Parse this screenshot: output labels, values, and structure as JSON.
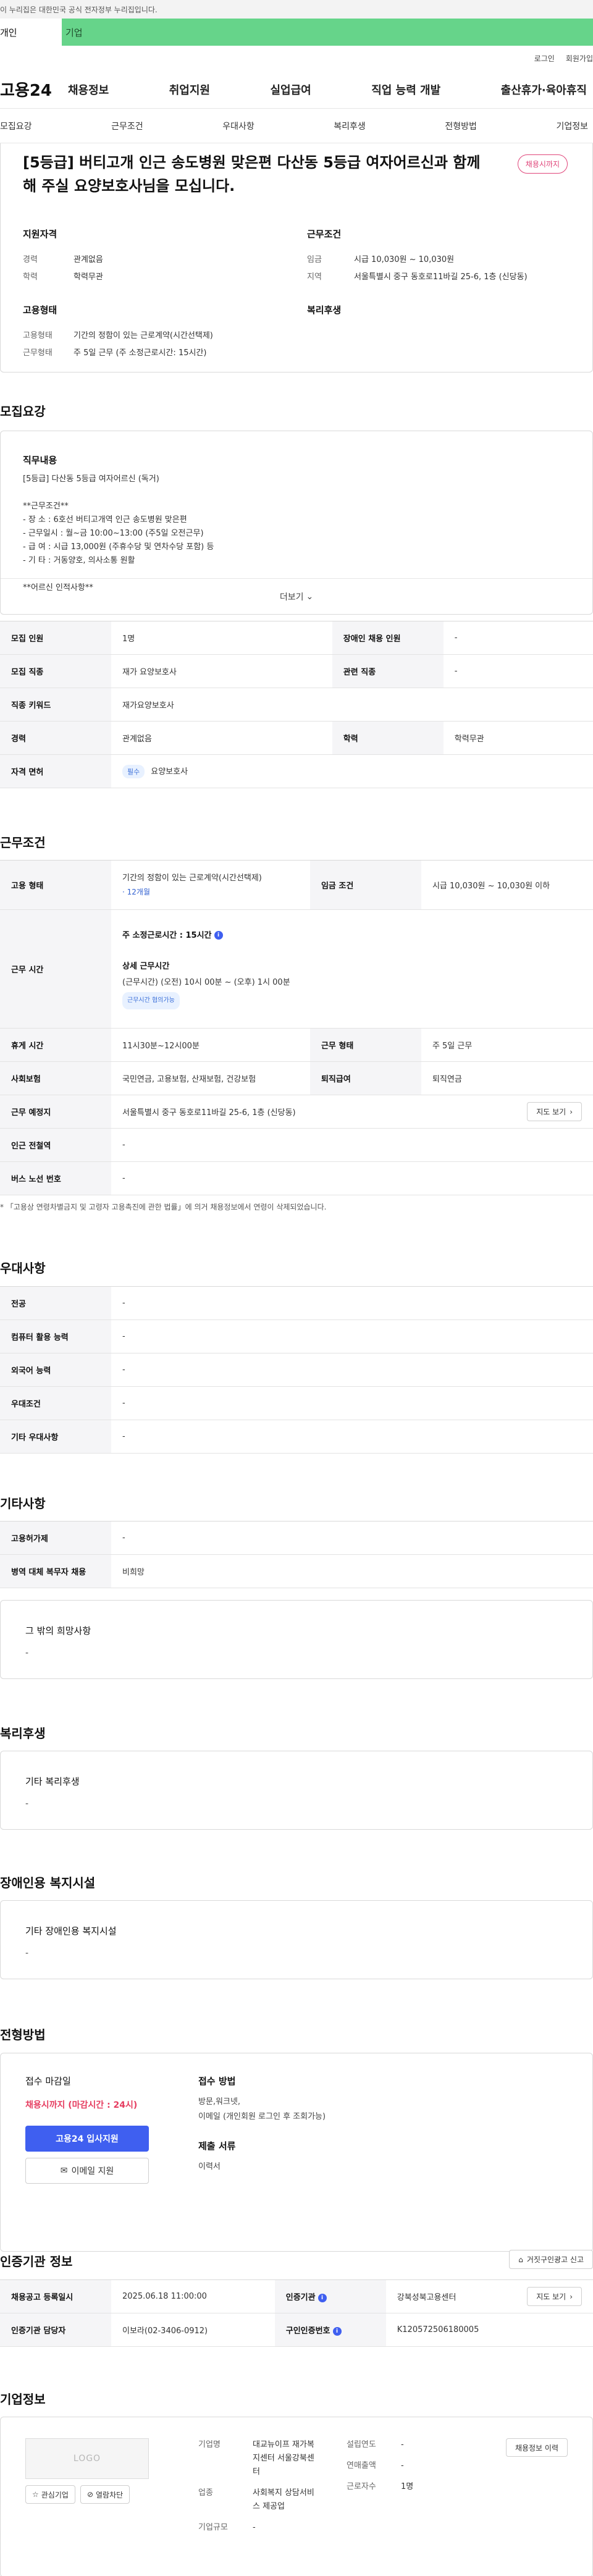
{
  "gov_banner": "이 누리집은 대한민국 공식 전자정부 누리집입니다.",
  "top_tabs": {
    "personal": "개인",
    "corporate": "기업"
  },
  "util_links": {
    "login": "로그인",
    "signup": "회원가입"
  },
  "logo": "고용24",
  "gnb": [
    "채용정보",
    "취업지원",
    "실업급여",
    "직업 능력 개발",
    "출산휴가·육아휴직"
  ],
  "subnav": [
    "모집요강",
    "근무조건",
    "우대사항",
    "복리후생",
    "전형방법",
    "기업정보"
  ],
  "job": {
    "title": "[5등급] 버티고개 인근 송도병원 맞은편 다산동 5등급 여자어르신과 함께해 주실 요양보호사님을 모십니다.",
    "status": "채용시까지",
    "summary": {
      "qualification_title": "지원자격",
      "career_key": "경력",
      "career_val": "관계없음",
      "education_key": "학력",
      "education_val": "학력무관",
      "conditions_title": "근무조건",
      "wage_key": "임금",
      "wage_val": "시급 10,030원 ~ 10,030원",
      "region_key": "지역",
      "region_val": "서울특별시 중구 동호로11바길 25-6, 1층 (신당동)",
      "employment_title": "고용형태",
      "emp_type_key": "고용형태",
      "emp_type_val": "기간의 정함이 있는 근로계약(시간선택제)",
      "work_key": "근무형태",
      "work_val": "주 5일 근무 (주 소정근로시간: 15시간)",
      "welfare_title": "복리후생"
    }
  },
  "recruit": {
    "section_title": "모집요강",
    "desc_title": "직무내용",
    "desc_text": "[5등급] 다산동 5등급 여자어르신 (독거)\n\n**근무조건**\n- 장   소 : 6호선 버티고개역 인근 송도병원 맞은편\n- 근무일시 : 월~금 10:00~13:00 (주5일 오전근무)\n- 급   여 : 시급 13,000원 (주휴수당 및 연차수당 포함) 등\n- 기   타 : 거동양호,   의사소통 원활\n\n**어르신 인적사항**",
    "more_label": "더보기",
    "table": {
      "headcount_k": "모집 인원",
      "headcount_v": "1명",
      "disabled_k": "장애인 채용 인원",
      "disabled_v": "-",
      "job_k": "모집 직종",
      "job_v": "재가 요양보호사",
      "related_k": "관련 직종",
      "related_v": "-",
      "keyword_k": "직종 키워드",
      "keyword_v": "재가요양보호사",
      "career_k": "경력",
      "career_v": "관계없음",
      "edu_k": "학력",
      "edu_v": "학력무관",
      "license_k": "자격 면허",
      "license_badge": "필수",
      "license_v": "요양보호사"
    }
  },
  "conditions": {
    "section_title": "근무조건",
    "emp_type_k": "고용 형태",
    "emp_type_v": "기간의 정함이 있는 근로계약(시간선택제)",
    "emp_period": "· 12개월",
    "wage_k": "임금 조건",
    "wage_v": "시급 10,030원 ~ 10,030원 이하",
    "hours_k": "근무 시간",
    "weekly_hours": "주 소정근로시간 : 15시간",
    "detail_title": "상세 근무시간",
    "detail_time": "(근무시간) (오전) 10시 00분 ~ (오후) 1시 00분",
    "flex_badge": "근무시간 협의가능",
    "break_k": "휴게 시간",
    "break_v": "11시30분~12시00분",
    "work_type_k": "근무 형태",
    "work_type_v": "주 5일 근무",
    "insurance_k": "사회보험",
    "insurance_v": "국민연금, 고용보험, 산재보험, 건강보험",
    "severance_k": "퇴직급여",
    "severance_v": "퇴직연금",
    "place_k": "근무 예정지",
    "place_v": "서울특별시 중구 동호로11바길 25-6, 1층 (신당동)",
    "map_btn": "지도 보기",
    "subway_k": "인근 전철역",
    "subway_v": "-",
    "bus_k": "버스 노선 번호",
    "bus_v": "-",
    "footnote": "* 「고용상 연령차별금지 및 고령자 고용촉진에 관한 법률」에 의거 채용정보에서 연령이 삭제되었습니다."
  },
  "preference": {
    "section_title": "우대사항",
    "major_k": "전공",
    "major_v": "-",
    "computer_k": "컴퓨터 활용 능력",
    "computer_v": "-",
    "language_k": "외국어 능력",
    "language_v": "-",
    "pref_k": "우대조건",
    "pref_v": "-",
    "etc_k": "기타 우대사항",
    "etc_v": "-"
  },
  "etc": {
    "section_title": "기타사항",
    "equip_k": "고용허가제",
    "equip_v": "-",
    "military_k": "병역 대체 복무자 채용",
    "military_v": "비희망",
    "other_title": "그 밖의 희망사항",
    "other_v": "-"
  },
  "welfare": {
    "section_title": "복리후생",
    "title": "기타 복리후생",
    "value": "-"
  },
  "disability": {
    "section_title": "장애인용 복지시설",
    "title": "기타 장애인용 복지시설",
    "value": "-"
  },
  "selection": {
    "section_title": "전형방법",
    "deadline_title": "접수 마감일",
    "deadline": "채용시까지 (마감시간 : 24시)",
    "apply_btn": "고용24 입사지원",
    "email_btn": "이메일 지원",
    "method_title": "접수 방법",
    "methods": "방문,워크넷,\n이메일 (개인회원 로그인 후 조회가능)",
    "docs_title": "제출 서류",
    "docs": "이력서"
  },
  "cert": {
    "section_title": "인증기관 정보",
    "notice_btn": "거짓구인광고 신고",
    "reg_k": "채용공고 등록일시",
    "reg_v": "2025.06.18 11:00:00",
    "agency_k": "인증기관",
    "agency_v": "강북성북고용센터",
    "map_btn": "지도 보기",
    "manager_k": "인증기관 담당자",
    "manager_v": "이보라(02-3406-0912)",
    "cert_no_k": "구인인증번호",
    "cert_no_v": "K120572506180005"
  },
  "corp": {
    "section_title": "기업정보",
    "logo_text": "LOGO",
    "interest_btn": "관심기업",
    "block_btn": "열람차단",
    "name_k": "기업명",
    "name_v": "대교뉴이프 재가복지센터 서울강북센터",
    "industry_k": "업종",
    "industry_v": "사회복지 상담서비스 제공업",
    "size_k": "기업규모",
    "size_v": "-",
    "founded_k": "설립연도",
    "founded_v": "-",
    "sales_k": "연매출액",
    "sales_v": "-",
    "staff_k": "근로자수",
    "staff_v": "1명",
    "more_jobs_btn": "채용정보 이력"
  }
}
